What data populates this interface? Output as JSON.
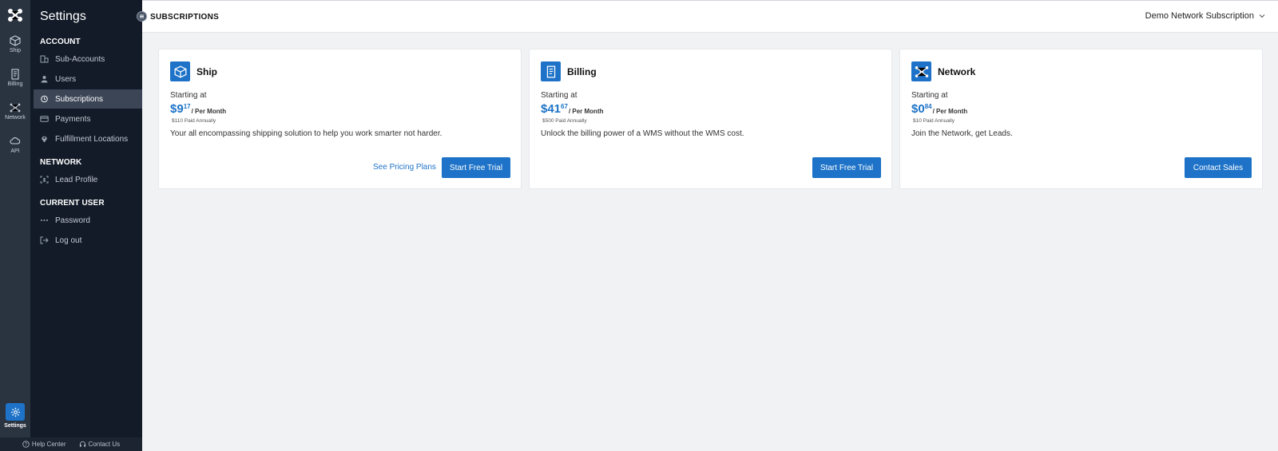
{
  "rail": {
    "items": [
      {
        "label": "Ship",
        "icon": "cube-icon"
      },
      {
        "label": "Billing",
        "icon": "receipt-icon"
      },
      {
        "label": "Network",
        "icon": "network-icon"
      },
      {
        "label": "API",
        "icon": "cloud-icon"
      }
    ],
    "settings_label": "Settings"
  },
  "sidebar": {
    "title": "Settings",
    "sections": {
      "account": "ACCOUNT",
      "network": "NETWORK",
      "current_user": "CURRENT USER"
    },
    "items": {
      "sub_accounts": "Sub-Accounts",
      "users": "Users",
      "subscriptions": "Subscriptions",
      "payments": "Payments",
      "fulfillment_locations": "Fulfillment Locations",
      "lead_profile": "Lead Profile",
      "password": "Password",
      "log_out": "Log out"
    },
    "active": "subscriptions"
  },
  "footer": {
    "help_center": "Help Center",
    "contact_us": "Contact Us"
  },
  "header": {
    "title": "SUBSCRIPTIONS",
    "account": "Demo Network Subscription"
  },
  "cards": [
    {
      "name": "Ship",
      "icon": "cube-icon",
      "starting": "Starting at",
      "price_dollars": "$9",
      "price_cents": "17",
      "per": "/ Per Month",
      "annual": "$110 Paid Annually",
      "description": "Your all encompassing shipping solution to help you work smarter not harder.",
      "link": "See Pricing Plans",
      "button": "Start Free Trial"
    },
    {
      "name": "Billing",
      "icon": "receipt-icon",
      "starting": "Starting at",
      "price_dollars": "$41",
      "price_cents": "67",
      "per": "/ Per Month",
      "annual": "$500 Paid Annually",
      "description": "Unlock the billing power of a WMS without the WMS cost.",
      "button": "Start Free Trial"
    },
    {
      "name": "Network",
      "icon": "network-icon",
      "starting": "Starting at",
      "price_dollars": "$0",
      "price_cents": "84",
      "per": "/ Per Month",
      "annual": "$10 Paid Annually",
      "description": "Join the Network, get Leads.",
      "button": "Contact Sales"
    }
  ],
  "colors": {
    "accent": "#1e73c8",
    "sidebar_bg": "#131b28",
    "rail_bg": "#2a3340",
    "page_bg": "#f1f2f4"
  }
}
